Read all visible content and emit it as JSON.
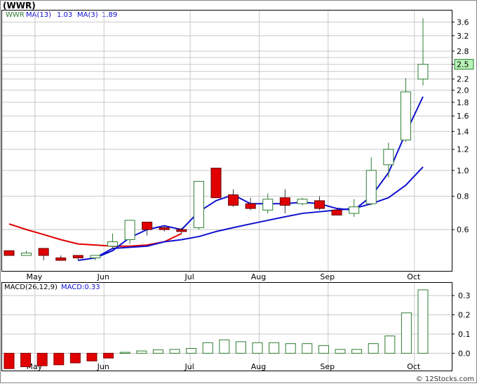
{
  "title": "(WWR)",
  "legend": {
    "symbol": "WWR",
    "ma13_label": "MA(13)",
    "ma13_value": "1.03",
    "ma3_label": "MA(3)",
    "ma3_value": "1.89"
  },
  "macd_legend": {
    "label": "MACD(26,12,9)",
    "value_label": "MACD:0.33"
  },
  "watermark": "© 12Stocks.com",
  "colors": {
    "up": "#2e7d32",
    "down": "#e00000",
    "ma3": "#1010d0",
    "ma13": "#1010d0",
    "ma_early": "#e00000",
    "grid": "#c8c8c8",
    "border": "#000000",
    "last_price_box": "#b6f3b6"
  },
  "chart_data": [
    {
      "type": "candlestick",
      "scale": "log",
      "ylim": [
        0.42,
        4.0
      ],
      "ticks": [
        "3.6",
        "3.2",
        "2.8",
        "2.5",
        "2.2",
        "2.0",
        "1.8",
        "1.6",
        "1.4",
        "1.2",
        "1.0",
        "0.8",
        "0.6"
      ],
      "tick_values": [
        3.6,
        3.2,
        2.8,
        2.5,
        2.2,
        2.0,
        1.8,
        1.6,
        1.4,
        1.2,
        1.0,
        0.8,
        0.6
      ],
      "last_price": "2.5",
      "months": [
        "May",
        "Jun",
        "Jul",
        "Aug",
        "Sep",
        "Oct"
      ],
      "month_candle_index": [
        1.5,
        5.5,
        10.5,
        14.5,
        18.5,
        23.5
      ],
      "candles": [
        {
          "o": 0.5,
          "h": 0.5,
          "l": 0.48,
          "c": 0.48
        },
        {
          "o": 0.48,
          "h": 0.5,
          "l": 0.48,
          "c": 0.49
        },
        {
          "o": 0.51,
          "h": 0.51,
          "l": 0.46,
          "c": 0.48
        },
        {
          "o": 0.47,
          "h": 0.48,
          "l": 0.46,
          "c": 0.46
        },
        {
          "o": 0.48,
          "h": 0.48,
          "l": 0.46,
          "c": 0.47
        },
        {
          "o": 0.47,
          "h": 0.48,
          "l": 0.46,
          "c": 0.48
        },
        {
          "o": 0.52,
          "h": 0.58,
          "l": 0.51,
          "c": 0.54
        },
        {
          "o": 0.55,
          "h": 0.65,
          "l": 0.53,
          "c": 0.65
        },
        {
          "o": 0.64,
          "h": 0.64,
          "l": 0.57,
          "c": 0.6
        },
        {
          "o": 0.61,
          "h": 0.62,
          "l": 0.59,
          "c": 0.6
        },
        {
          "o": 0.6,
          "h": 0.61,
          "l": 0.58,
          "c": 0.59
        },
        {
          "o": 0.61,
          "h": 0.91,
          "l": 0.6,
          "c": 0.91
        },
        {
          "o": 1.02,
          "h": 1.02,
          "l": 0.79,
          "c": 0.79
        },
        {
          "o": 0.81,
          "h": 0.85,
          "l": 0.73,
          "c": 0.74
        },
        {
          "o": 0.75,
          "h": 0.79,
          "l": 0.71,
          "c": 0.72
        },
        {
          "o": 0.71,
          "h": 0.82,
          "l": 0.69,
          "c": 0.78
        },
        {
          "o": 0.79,
          "h": 0.85,
          "l": 0.69,
          "c": 0.74
        },
        {
          "o": 0.75,
          "h": 0.79,
          "l": 0.74,
          "c": 0.78
        },
        {
          "o": 0.77,
          "h": 0.8,
          "l": 0.71,
          "c": 0.72
        },
        {
          "o": 0.71,
          "h": 0.72,
          "l": 0.68,
          "c": 0.68
        },
        {
          "o": 0.69,
          "h": 0.78,
          "l": 0.67,
          "c": 0.73
        },
        {
          "o": 0.75,
          "h": 1.12,
          "l": 0.74,
          "c": 1.0
        },
        {
          "o": 1.05,
          "h": 1.27,
          "l": 0.94,
          "c": 1.2
        },
        {
          "o": 1.3,
          "h": 2.22,
          "l": 1.28,
          "c": 1.97
        },
        {
          "o": 2.2,
          "h": 3.72,
          "l": 2.08,
          "c": 2.5
        }
      ],
      "ma3": [
        0.49,
        0.49,
        0.49,
        0.48,
        0.47,
        0.47,
        0.5,
        0.56,
        0.6,
        0.62,
        0.6,
        0.7,
        0.77,
        0.81,
        0.75,
        0.75,
        0.75,
        0.76,
        0.75,
        0.72,
        0.71,
        0.8,
        0.98,
        1.38,
        1.89
      ],
      "ma13": [
        null,
        null,
        null,
        null,
        0.46,
        0.47,
        0.51,
        0.515,
        0.52,
        0.54,
        0.55,
        0.565,
        0.59,
        0.61,
        0.63,
        0.65,
        0.67,
        0.69,
        0.7,
        0.71,
        0.72,
        0.75,
        0.79,
        0.88,
        1.03
      ],
      "ma_early_red": [
        0.63,
        0.6,
        0.575,
        0.55,
        0.53,
        0.525,
        0.52,
        0.52,
        0.525,
        0.54,
        0.58
      ]
    },
    {
      "type": "bar",
      "title": "MACD(26,12,9)",
      "ylim": [
        -0.09,
        0.37
      ],
      "ticks": [
        "0.3",
        "0.2",
        "0.1",
        "0.0"
      ],
      "tick_values": [
        0.3,
        0.2,
        0.1,
        0.0
      ],
      "values": [
        -0.08,
        -0.07,
        -0.065,
        -0.06,
        -0.05,
        -0.04,
        -0.025,
        0.005,
        0.012,
        0.018,
        0.02,
        0.025,
        0.055,
        0.07,
        0.06,
        0.055,
        0.055,
        0.05,
        0.05,
        0.04,
        0.02,
        0.02,
        0.05,
        0.09,
        0.21,
        0.33
      ]
    }
  ]
}
